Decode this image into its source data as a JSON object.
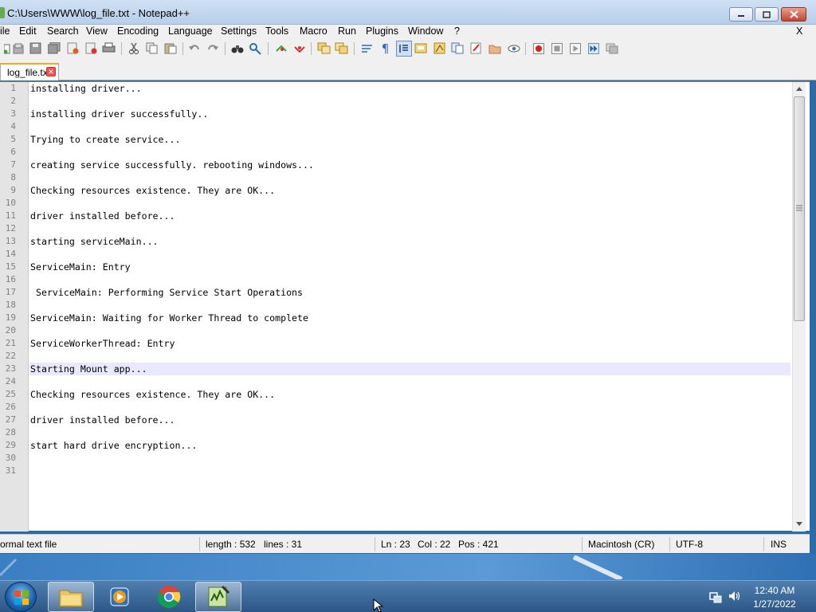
{
  "window": {
    "title": "C:\\Users\\WWW\\log_file.txt - Notepad++",
    "close_x": "X"
  },
  "menu": [
    "ile",
    "Edit",
    "Search",
    "View",
    "Encoding",
    "Language",
    "Settings",
    "Tools",
    "Macro",
    "Run",
    "Plugins",
    "Window",
    "?"
  ],
  "tab": {
    "label": "log_file.txt"
  },
  "editor": {
    "line_numbers": [
      "1",
      "2",
      "3",
      "4",
      "5",
      "6",
      "7",
      "8",
      "9",
      "10",
      "11",
      "12",
      "13",
      "14",
      "15",
      "16",
      "17",
      "18",
      "19",
      "20",
      "21",
      "22",
      "23",
      "24",
      "25",
      "26",
      "27",
      "28",
      "29",
      "30",
      "31"
    ],
    "lines": [
      "installing driver...",
      "",
      "installing driver successfully..",
      "",
      "Trying to create service...",
      "",
      "creating service successfully. rebooting windows...",
      "",
      "Checking resources existence. They are OK...",
      "",
      "driver installed before...",
      "",
      "starting serviceMain...",
      "",
      "ServiceMain: Entry",
      "",
      " ServiceMain: Performing Service Start Operations",
      "",
      "ServiceMain: Waiting for Worker Thread to complete",
      "",
      "ServiceWorkerThread: Entry",
      "",
      "Starting Mount app...",
      "",
      "Checking resources existence. They are OK...",
      "",
      "driver installed before...",
      "",
      "start hard drive encryption...",
      "",
      ""
    ],
    "current_line": 23
  },
  "status": {
    "file_type": "ormal text file",
    "length": "length : 532",
    "lines": "lines : 31",
    "ln": "Ln : 23",
    "col": "Col : 22",
    "pos": "Pos : 421",
    "eol": "Macintosh (CR)",
    "encoding": "UTF-8",
    "mode": "INS"
  },
  "taskbar": {
    "time": "12:40 AM",
    "date": "1/27/2022"
  },
  "icons": {
    "toolbar": [
      "new-file",
      "open-file",
      "save",
      "save-all",
      "close",
      "close-all",
      "print",
      "cut",
      "copy",
      "paste",
      "undo",
      "redo",
      "find",
      "replace",
      "zoom-in",
      "zoom-out",
      "sync-v",
      "sync-h",
      "word-wrap",
      "show-all-chars",
      "indent-guide",
      "user-defined-lang",
      "doc-map",
      "function-list",
      "folder-as-workspace",
      "monitoring",
      "record-macro",
      "stop-macro",
      "play-macro",
      "run-macro-multiple",
      "save-macro"
    ],
    "taskbar": [
      "windows-start",
      "file-explorer",
      "media-player",
      "chrome",
      "notepadpp"
    ]
  }
}
